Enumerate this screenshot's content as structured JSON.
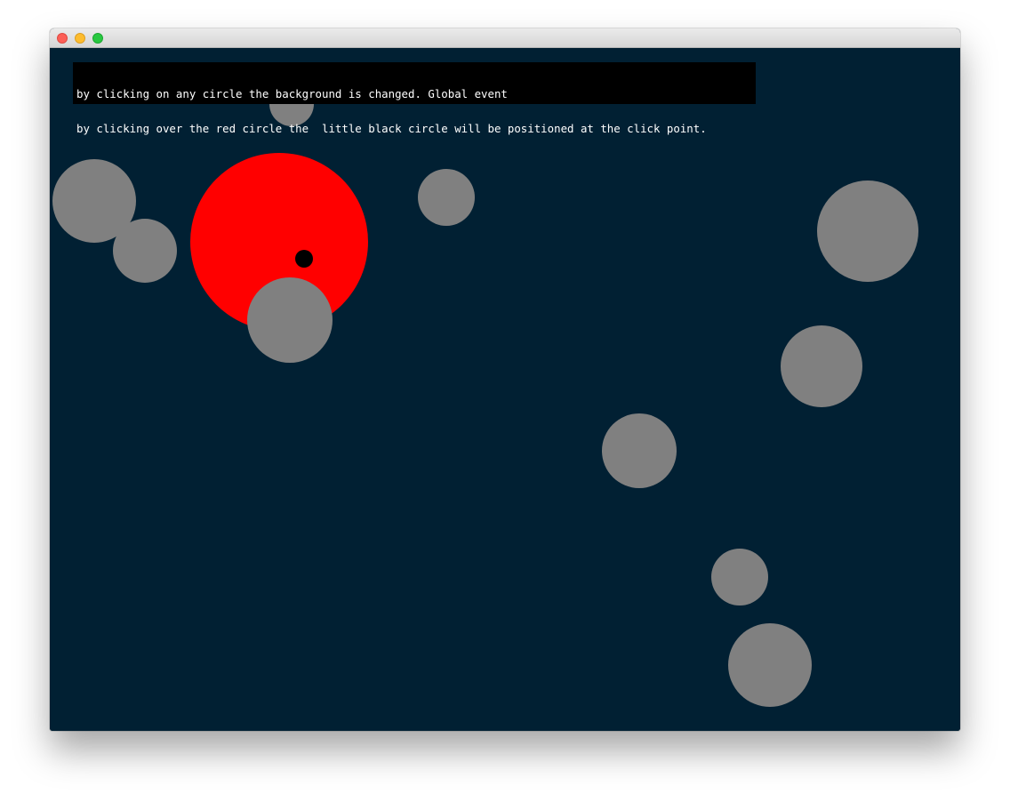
{
  "window": {
    "controls": [
      "close-button",
      "minimize-button",
      "zoom-button"
    ]
  },
  "scene": {
    "background": "#012033",
    "info": {
      "line1": "by clicking on any circle the background is changed. Global event",
      "line2": "by clicking over the red circle the  little black circle will be positioned at the click point."
    },
    "colors": {
      "grey_circle": "#808080",
      "red_circle": "#ff0000",
      "click_dot": "#000000"
    }
  }
}
